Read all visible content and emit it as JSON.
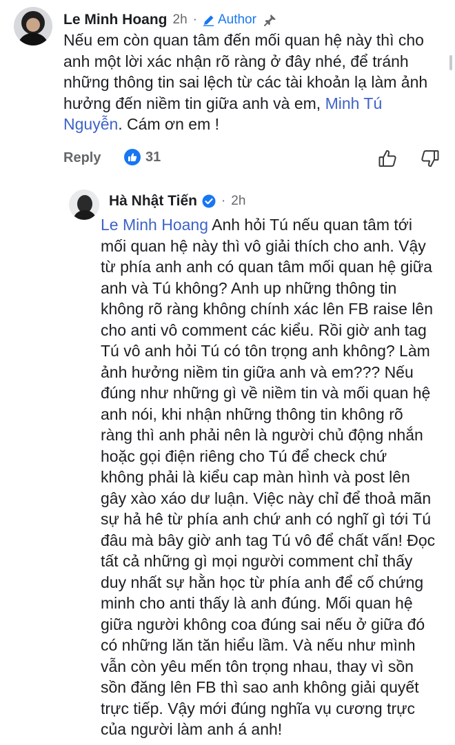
{
  "comment": {
    "author": "Le Minh Hoang",
    "time": "2h",
    "separator": "·",
    "author_badge": "Author",
    "text_lines": [
      "Nếu em còn quan tâm đến mối quan hệ này thì cho",
      "anh một lời xác nhận rõ ràng ở đây nhé, để tránh",
      "những thông tin sai lệch từ các tài khoản lạ làm ảnh",
      "hưởng đến niềm tin giữa anh và em, "
    ],
    "mention_part1": "Minh Tú",
    "mention_part2": "Nguyễn",
    "text_end": ". Cám ơn em !",
    "reply_label": "Reply",
    "like_count": "31"
  },
  "reply": {
    "author": "Hà Nhật Tiến",
    "time": "2h",
    "separator": "·",
    "mention": "Le Minh Hoang",
    "first_line_rest": " Anh hỏi Tú nếu quan tâm tới",
    "text_lines": [
      "mối quan hệ này thì vô giải thích cho anh. Vậy",
      "từ phía anh anh có quan tâm mối quan hệ giữa",
      "anh và Tú không? Anh up những thông tin",
      "không rõ ràng không chính xác lên FB raise lên",
      "cho anti vô comment các kiểu. Rồi giờ anh tag",
      "Tú vô anh hỏi Tú có tôn trọng anh không? Làm",
      "ảnh hưởng niềm tin giữa anh và em??? Nếu",
      "đúng như những gì về niềm tin và mối quan hệ",
      "anh nói, khi nhận những thông tin không rõ",
      "ràng thì anh phải nên là người chủ động nhắn",
      "hoặc gọi điện riêng cho Tú để check chứ",
      "không phải là kiểu cap màn hình và post lên",
      "gây xào xáo dư luận. Việc này chỉ để thoả mãn",
      "sự hả hê từ phía anh chứ anh có nghĩ gì tới Tú",
      "đâu mà bây giờ anh tag Tú vô để chất vấn! Đọc",
      "tất cả những gì mọi người comment chỉ thấy",
      "duy nhất sự hằn học từ phía anh để cố chứng",
      "minh cho anti thấy là anh đúng. Mối quan hệ",
      "giữa người không coa đúng sai nếu ở giữa đó",
      "có những lăn tăn hiểu lầm. Và nếu như mình",
      "vẫn còn yêu mến tôn trọng nhau, thay vì sồn",
      "sồn đăng lên FB thì sao anh không giải quyết",
      "trực tiếp. Vậy mới đúng nghĩa vụ cương trực",
      "của người làm anh á anh!"
    ]
  },
  "colors": {
    "link": "#3d63c7",
    "accent": "#1877f2",
    "meta": "#65676b",
    "text": "#1c1e21"
  },
  "icons": {
    "author_badge_icon": "pencil-icon",
    "pin_icon": "pin-icon",
    "like_reaction_icon": "like-reaction-icon",
    "thumb_up_icon": "thumbs-up-icon",
    "thumb_down_icon": "thumbs-down-icon",
    "verified_icon": "verified-badge-icon"
  }
}
